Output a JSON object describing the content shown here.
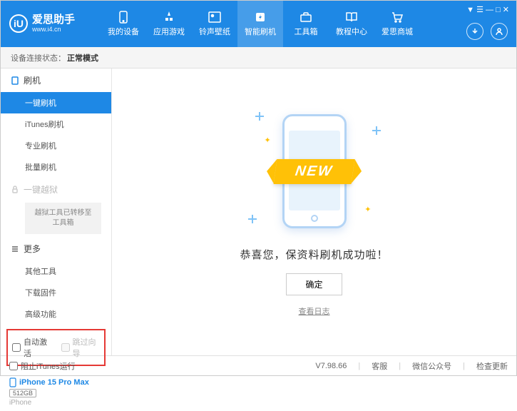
{
  "logo": {
    "glyph": "iU",
    "title": "爱思助手",
    "url": "www.i4.cn"
  },
  "nav": [
    {
      "label": "我的设备"
    },
    {
      "label": "应用游戏"
    },
    {
      "label": "铃声壁纸"
    },
    {
      "label": "智能刷机"
    },
    {
      "label": "工具箱"
    },
    {
      "label": "教程中心"
    },
    {
      "label": "爱思商城"
    }
  ],
  "status": {
    "label": "设备连接状态：",
    "value": "正常模式"
  },
  "sidebar": {
    "section1": {
      "title": "刷机"
    },
    "items1": [
      "一键刷机",
      "iTunes刷机",
      "专业刷机",
      "批量刷机"
    ],
    "section2": {
      "title": "一键越狱",
      "note": "越狱工具已转移至工具箱"
    },
    "section3": {
      "title": "更多"
    },
    "items3": [
      "其他工具",
      "下载固件",
      "高级功能"
    ],
    "checks": {
      "auto_activate": "自动激活",
      "skip_guide": "跳过向导"
    },
    "device": {
      "name": "iPhone 15 Pro Max",
      "storage": "512GB",
      "type": "iPhone"
    }
  },
  "main": {
    "ribbon": "NEW",
    "message": "恭喜您，保资料刷机成功啦！",
    "confirm": "确定",
    "log_link": "查看日志"
  },
  "footer": {
    "block_itunes": "阻止iTunes运行",
    "version": "V7.98.66",
    "items": [
      "客服",
      "微信公众号",
      "检查更新"
    ]
  },
  "window_controls": "▼ ☰ — □ ✕"
}
